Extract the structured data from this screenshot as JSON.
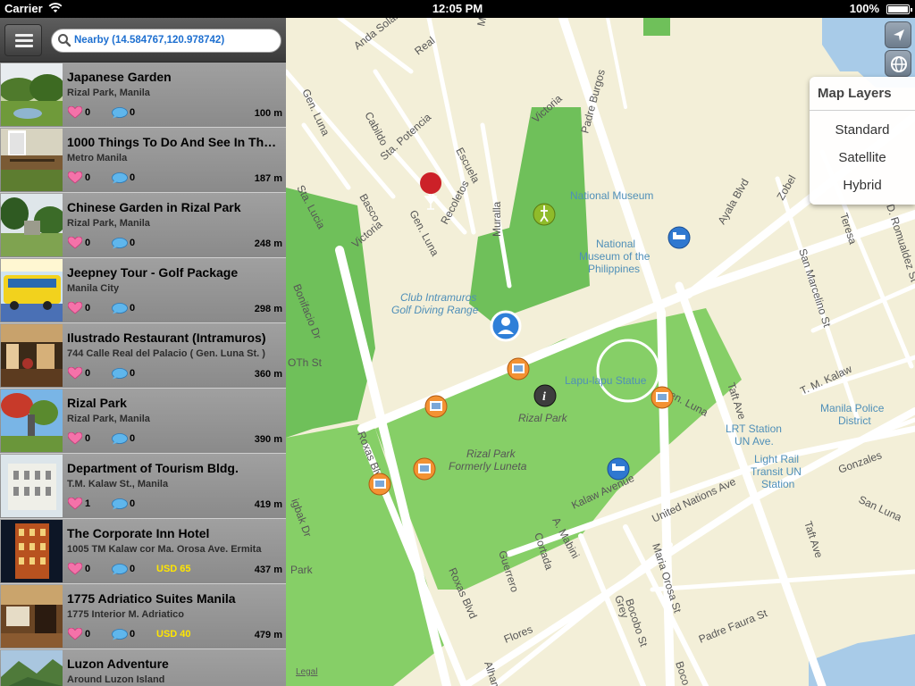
{
  "status_bar": {
    "carrier": "Carrier",
    "time": "12:05 PM",
    "battery": "100%"
  },
  "search": {
    "value": "Nearby (14.584767,120.978742)"
  },
  "places": [
    {
      "title": "Japanese Garden",
      "subtitle": "Rizal Park, Manila",
      "likes": "0",
      "comments": "0",
      "price": "",
      "distance": "100 m"
    },
    {
      "title": "1000 Things To Do And See In The Philippines",
      "subtitle": "Metro Manila",
      "likes": "0",
      "comments": "0",
      "price": "",
      "distance": "187 m"
    },
    {
      "title": "Chinese Garden in Rizal Park",
      "subtitle": "Rizal Park, Manila",
      "likes": "0",
      "comments": "0",
      "price": "",
      "distance": "248 m"
    },
    {
      "title": "Jeepney Tour - Golf Package",
      "subtitle": "Manila City",
      "likes": "0",
      "comments": "0",
      "price": "",
      "distance": "298 m"
    },
    {
      "title": "Ilustrado Restaurant (Intramuros)",
      "subtitle": "744 Calle Real del Palacio ( Gen. Luna St. )",
      "likes": "0",
      "comments": "0",
      "price": "",
      "distance": "360 m"
    },
    {
      "title": "Rizal Park",
      "subtitle": "Rizal Park, Manila",
      "likes": "0",
      "comments": "0",
      "price": "",
      "distance": "390 m"
    },
    {
      "title": "Department of Tourism Bldg.",
      "subtitle": "T.M. Kalaw St., Manila",
      "likes": "1",
      "comments": "0",
      "price": "",
      "distance": "419 m"
    },
    {
      "title": "The Corporate Inn Hotel",
      "subtitle": "1005 TM Kalaw cor Ma. Orosa Ave. Ermita",
      "likes": "0",
      "comments": "0",
      "price": "USD 65",
      "distance": "437 m"
    },
    {
      "title": "1775 Adriatico Suites Manila",
      "subtitle": "1775 Interior M. Adriatico",
      "likes": "0",
      "comments": "0",
      "price": "USD 40",
      "distance": "479 m"
    },
    {
      "title": "Luzon Adventure",
      "subtitle": "Around Luzon Island",
      "likes": "",
      "comments": "",
      "price": "",
      "distance": ""
    }
  ],
  "map_layers": {
    "header": "Map Layers",
    "options": [
      "Standard",
      "Satellite",
      "Hybrid"
    ]
  },
  "map_labels": {
    "anda_solana": "Anda Solana",
    "real": "Real",
    "muralla_top": "Muralla",
    "padre_burgos": "Padre Burgos",
    "gen_luna_top": "Gen. Luna",
    "cabildo": "Cabildo",
    "sta_potencia": "Sta. Potencia",
    "escuela": "Escuela",
    "victoria_top": "Victoria",
    "sta_lucia": "Sta. Lucia",
    "basco": "Basco",
    "victoria_mid": "Victoria",
    "gen_luna_mid": "Gen. Luna",
    "recoletos": "Recoletos",
    "muralla_mid": "Muralla",
    "national_museum": "National Museum",
    "nat_museum_ph_1": "National",
    "nat_museum_ph_2": "Museum of the",
    "nat_museum_ph_3": "Philippines",
    "ayala_blvd": "Ayala Blvd",
    "zobel": "Zobel",
    "teresa": "Teresa",
    "d_romualdez": "D. Romualdez St",
    "san_marcelino": "San Marcelino St",
    "club_intramuros_1": "Club Intramuros",
    "club_intramuros_2": "Golf Diving Range",
    "bonifacio_dr": "Bonifacio Dr",
    "oth_st": "OTh St",
    "roxas_blvd": "Roxas Blvd",
    "lapu_lapu": "Lapu-lapu Statue",
    "rizal_park": "Rizal Park",
    "rizal_park_luneta_1": "Rizal Park",
    "rizal_park_luneta_2": "Formerly Luneta",
    "gen_luna_low": "Gen. Luna",
    "tm_kalaw_right": "T. M. Kalaw",
    "taft_ave": "Taft Ave",
    "lrt_1": "LRT Station",
    "lrt_2": "UN Ave.",
    "light_rail_1": "Light Rail",
    "light_rail_2": "Transit UN",
    "light_rail_3": "Station",
    "manila_police_1": "Manila Police",
    "manila_police_2": "District",
    "gonzales": "Gonzales",
    "san_luna": "San Luna",
    "kalaw_ave": "Kalaw Avenue",
    "un_ave": "United Nations Ave",
    "a_mabini": "A. Mabini",
    "cortada": "Cortada",
    "guerrero": "Guerrero",
    "maria_orosa": "Maria Orosa St",
    "bocobo": "Bocobo St",
    "grey": "Grey",
    "padre_faura": "Padre Faura St",
    "flores": "Flores",
    "alhambra": "Alhambra",
    "taft_ave_low": "Taft Ave",
    "park_left": "Park",
    "bigbak": "igbak Dr",
    "roxas_blvd_low": "Roxas Blvd",
    "bocobo_low": "Boco"
  },
  "legal": "Legal"
}
